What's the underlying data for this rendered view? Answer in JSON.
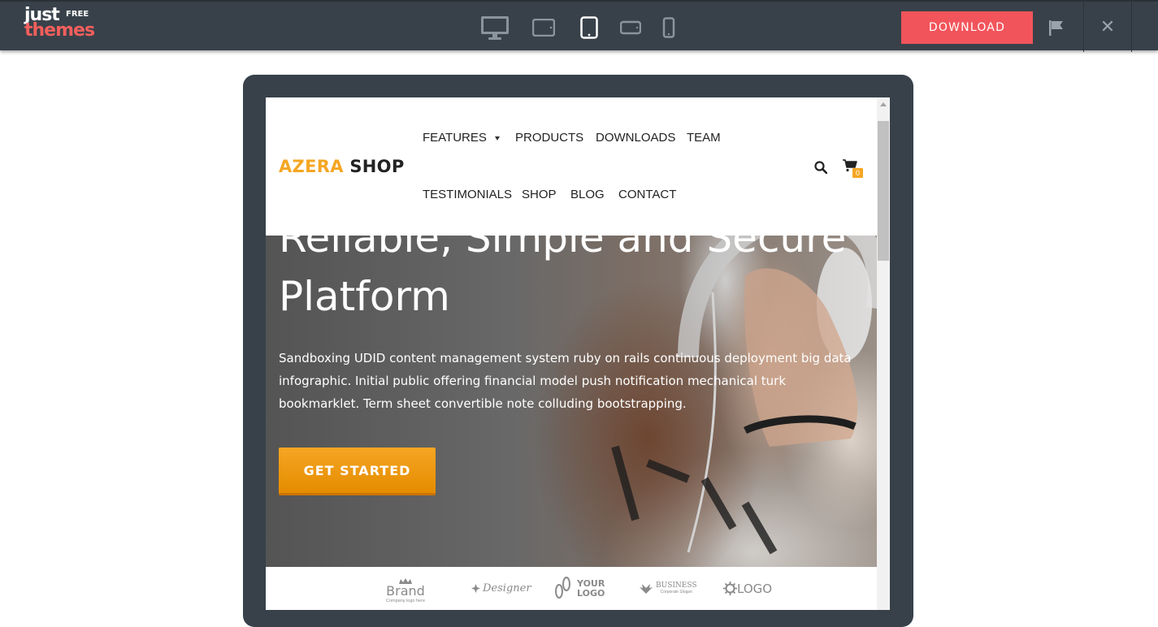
{
  "logo": {
    "just": "just",
    "free": "FREE",
    "themes": "themes"
  },
  "devices": [
    {
      "name": "desktop",
      "active": false
    },
    {
      "name": "tablet-landscape",
      "active": false
    },
    {
      "name": "tablet-portrait",
      "active": true
    },
    {
      "name": "phone-landscape",
      "active": false
    },
    {
      "name": "phone-portrait",
      "active": false
    }
  ],
  "toolbar": {
    "download_label": "DOWNLOAD",
    "close_label": "✕"
  },
  "site": {
    "brand_primary": "AZERA",
    "brand_secondary": "SHOP",
    "nav_row1": [
      "FEATURES",
      "PRODUCTS",
      "DOWNLOADS",
      "TEAM"
    ],
    "nav_row2": [
      "TESTIMONIALS",
      "SHOP",
      "BLOG",
      "CONTACT"
    ],
    "cart_count": "0",
    "hero": {
      "title_line1": "Reliable, Simple and Secure",
      "title_line2": "Platform",
      "text": "Sandboxing UDID content management system ruby on rails continuous deployment big data infographic. Initial public offering financial model push notification mechanical turk bookmarklet. Term sheet convertible note colluding bootstrapping.",
      "cta_label": "GET STARTED"
    },
    "brand_logos": [
      {
        "main": "Brand",
        "sub": "Company logo here"
      },
      {
        "main": "Designer"
      },
      {
        "main": "YOUR",
        "sub": "LOGO"
      },
      {
        "main": "BUSINESS",
        "sub": "Corporate Slogan"
      },
      {
        "main": "LOGO"
      }
    ]
  },
  "colors": {
    "accent": "#f5a623",
    "download": "#f2545b",
    "bar": "#38414a"
  }
}
